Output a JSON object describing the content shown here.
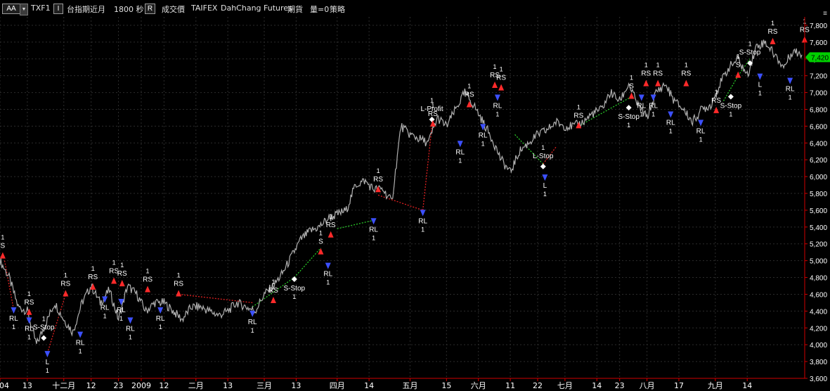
{
  "toolbar": {
    "dropdown_label": "AA",
    "symbol": "TXF1",
    "mode_indicator": "I",
    "name": "台指期近月",
    "interval": "1800 秒",
    "r_indicator": "R",
    "price_type": "成交價",
    "exchange": "TAIFEX",
    "source": "DahChang Futures",
    "market": "期貨",
    "volume": "量=0",
    "strategy": "策略",
    "panel_icon": "≡"
  },
  "colors": {
    "background": "#000000",
    "price_line": "#b0b0b0",
    "grid": "#2c2c2c",
    "axis": "#d00000",
    "long_segment": "#28c828",
    "short_segment": "#e02020",
    "buy_marker": "#3c50ff",
    "sell_marker": "#ff2a2a",
    "exit_marker": "#ffffff",
    "last_price_tag": "#00d000"
  },
  "chart_data": {
    "type": "line",
    "y_ticks": [
      3600,
      3800,
      4000,
      4200,
      4400,
      4600,
      4800,
      5000,
      5200,
      5400,
      5600,
      5800,
      6000,
      6200,
      6400,
      6600,
      6800,
      7000,
      7200,
      7400,
      7600,
      7800
    ],
    "y_tick_labels": [
      "3,600",
      "3,800",
      "4,000",
      "4,200",
      "4,400",
      "4,600",
      "4,800",
      "5,000",
      "5,200",
      "5,400",
      "5,600",
      "5,800",
      "6,000",
      "6,200",
      "6,400",
      "6,600",
      "6,800",
      "7,000",
      "7,200",
      "7,400",
      "7,600",
      "7,800"
    ],
    "ylim": [
      3600,
      7900
    ],
    "x_ticks": [
      "04",
      "13",
      "十二月",
      "12",
      "23",
      "2009",
      "12",
      "二月",
      "13",
      "三月",
      "13",
      "四月",
      "14",
      "五月",
      "15",
      "六月",
      "11",
      "22",
      "七月",
      "14",
      "23",
      "八月",
      "17",
      "九月",
      "14"
    ],
    "x_tick_pos": [
      0,
      3,
      7,
      10,
      13,
      15.5,
      18,
      21.5,
      25,
      29,
      32.5,
      37,
      40.5,
      45,
      49,
      52.5,
      56,
      59,
      62,
      65.5,
      68,
      71,
      74.5,
      78.5,
      82
    ],
    "xlim": [
      0,
      88
    ],
    "last_price": 7420,
    "last_price_label": "7,420",
    "series": [
      {
        "x": [
          0,
          1,
          2,
          3,
          4,
          5,
          6,
          7,
          8,
          9,
          10,
          11,
          12,
          13,
          14,
          15,
          16,
          17,
          18,
          19,
          20,
          21,
          22,
          23,
          24,
          25,
          26,
          27,
          28,
          29,
          30,
          31,
          32,
          33,
          34,
          35,
          36,
          37,
          38,
          39,
          40,
          41,
          42,
          43,
          44,
          45,
          46,
          47,
          48,
          49,
          50,
          51,
          52,
          53,
          54,
          55,
          56,
          57,
          58,
          59,
          60,
          61,
          62,
          63,
          64,
          65,
          66,
          67,
          68,
          69,
          70,
          71,
          72,
          73,
          74,
          75,
          76,
          77,
          78,
          79,
          80,
          81,
          82,
          83,
          84,
          85,
          86,
          87,
          88
        ],
        "values": [
          5000,
          4800,
          4450,
          4400,
          4000,
          4250,
          4500,
          4300,
          4150,
          4500,
          4700,
          4500,
          4650,
          4300,
          4700,
          4600,
          4400,
          4500,
          4500,
          4400,
          4300,
          4450,
          4450,
          4400,
          4350,
          4400,
          4500,
          4450,
          4400,
          4600,
          4700,
          4850,
          5050,
          5250,
          5350,
          5400,
          5500,
          5550,
          5600,
          5900,
          5950,
          5850,
          5850,
          5700,
          6600,
          6500,
          6450,
          6400,
          6700,
          6600,
          6800,
          7000,
          6850,
          6650,
          6450,
          6200,
          6050,
          6300,
          6400,
          6500,
          6550,
          6650,
          6600,
          6600,
          6650,
          6750,
          6800,
          7000,
          6900,
          7100,
          6850,
          6700,
          7000,
          7100,
          6900,
          6800,
          6650,
          6800,
          6850,
          7100,
          7300,
          7400,
          7200,
          7550,
          7600,
          7450,
          7300,
          7500,
          7450
        ]
      }
    ],
    "signals": [
      {
        "x": 0.3,
        "y": 5050,
        "type": "sell",
        "label": "S",
        "qty": "1",
        "pos": "above"
      },
      {
        "x": 1.5,
        "y": 4420,
        "type": "buy",
        "label": "RL",
        "qty": "1",
        "pos": "below"
      },
      {
        "x": 3.2,
        "y": 4380,
        "type": "sell",
        "label": "RS",
        "qty": "1",
        "pos": "above"
      },
      {
        "x": 3.2,
        "y": 4300,
        "type": "buy",
        "label": "RL",
        "qty": "1",
        "pos": "below"
      },
      {
        "x": 4.8,
        "y": 4080,
        "type": "exit",
        "label": "S-Stop",
        "qty": "1",
        "pos": "above"
      },
      {
        "x": 5.2,
        "y": 3900,
        "type": "buy",
        "label": "L",
        "qty": "1",
        "pos": "below"
      },
      {
        "x": 7.2,
        "y": 4600,
        "type": "sell",
        "label": "RS",
        "qty": "1",
        "pos": "above"
      },
      {
        "x": 8.8,
        "y": 4130,
        "type": "buy",
        "label": "RL",
        "qty": "1",
        "pos": "below"
      },
      {
        "x": 10.2,
        "y": 4680,
        "type": "sell",
        "label": "RS",
        "qty": "1",
        "pos": "above"
      },
      {
        "x": 11.5,
        "y": 4550,
        "type": "buy",
        "label": "RL",
        "qty": "1",
        "pos": "below"
      },
      {
        "x": 12.5,
        "y": 4750,
        "type": "sell",
        "label": "RS",
        "qty": "1",
        "pos": "above"
      },
      {
        "x": 13.4,
        "y": 4720,
        "type": "sell",
        "label": "RS",
        "qty": "1",
        "pos": "above"
      },
      {
        "x": 13.3,
        "y": 4520,
        "type": "buy",
        "label": "RL",
        "qty": "1",
        "pos": "below"
      },
      {
        "x": 14.3,
        "y": 4300,
        "type": "buy",
        "label": "RL",
        "qty": "1",
        "pos": "below"
      },
      {
        "x": 16.2,
        "y": 4650,
        "type": "sell",
        "label": "RS",
        "qty": "1",
        "pos": "above"
      },
      {
        "x": 17.6,
        "y": 4420,
        "type": "buy",
        "label": "RL",
        "qty": "1",
        "pos": "below"
      },
      {
        "x": 19.6,
        "y": 4600,
        "type": "sell",
        "label": "RS",
        "qty": "1",
        "pos": "above"
      },
      {
        "x": 27.7,
        "y": 4380,
        "type": "buy",
        "label": "RL",
        "qty": "1",
        "pos": "below"
      },
      {
        "x": 30.0,
        "y": 4520,
        "type": "sell",
        "label": "RS",
        "qty": "1",
        "pos": "above"
      },
      {
        "x": 32.3,
        "y": 4780,
        "type": "exit",
        "label": "S-Stop",
        "qty": "1",
        "pos": "below"
      },
      {
        "x": 35.2,
        "y": 5100,
        "type": "sell",
        "label": "S",
        "qty": "1",
        "pos": "above"
      },
      {
        "x": 36.3,
        "y": 5300,
        "type": "sell",
        "label": "RS",
        "qty": "1",
        "pos": "above"
      },
      {
        "x": 36.0,
        "y": 4950,
        "type": "buy",
        "label": "RL",
        "qty": "1",
        "pos": "below"
      },
      {
        "x": 41.0,
        "y": 5480,
        "type": "buy",
        "label": "RL",
        "qty": "1",
        "pos": "below"
      },
      {
        "x": 41.5,
        "y": 5840,
        "type": "sell",
        "label": "RS",
        "qty": "1",
        "pos": "above"
      },
      {
        "x": 46.4,
        "y": 5580,
        "type": "buy",
        "label": "RL",
        "qty": "1",
        "pos": "below"
      },
      {
        "x": 47.4,
        "y": 6680,
        "type": "exit",
        "label": "L-Profit",
        "qty": "1",
        "pos": "above"
      },
      {
        "x": 47.5,
        "y": 6620,
        "type": "sell",
        "label": "RS",
        "qty": "1",
        "pos": "above"
      },
      {
        "x": 50.5,
        "y": 6400,
        "type": "buy",
        "label": "RL",
        "qty": "1",
        "pos": "below"
      },
      {
        "x": 51.5,
        "y": 6850,
        "type": "sell",
        "label": "RS",
        "qty": "1",
        "pos": "above"
      },
      {
        "x": 53.0,
        "y": 6600,
        "type": "buy",
        "label": "RL",
        "qty": "1",
        "pos": "below"
      },
      {
        "x": 54.3,
        "y": 7080,
        "type": "sell",
        "label": "RS",
        "qty": "1",
        "pos": "above"
      },
      {
        "x": 54.6,
        "y": 6950,
        "type": "buy",
        "label": "RL",
        "qty": "1",
        "pos": "below"
      },
      {
        "x": 55.0,
        "y": 7050,
        "type": "sell",
        "label": "RS",
        "qty": "1",
        "pos": "above"
      },
      {
        "x": 59.6,
        "y": 6120,
        "type": "exit",
        "label": "L-Stop",
        "qty": "1",
        "pos": "above"
      },
      {
        "x": 59.8,
        "y": 6000,
        "type": "buy",
        "label": "L",
        "qty": "1",
        "pos": "below"
      },
      {
        "x": 63.5,
        "y": 6600,
        "type": "sell",
        "label": "RS",
        "qty": "1",
        "pos": "above"
      },
      {
        "x": 69.0,
        "y": 6820,
        "type": "exit",
        "label": "S-Stop",
        "qty": "1",
        "pos": "below"
      },
      {
        "x": 69.3,
        "y": 6950,
        "type": "sell",
        "label": "S",
        "qty": "1",
        "pos": "above"
      },
      {
        "x": 70.4,
        "y": 6950,
        "type": "buy",
        "label": "RL",
        "qty": "1",
        "pos": "below"
      },
      {
        "x": 70.9,
        "y": 7100,
        "type": "sell",
        "label": "RS",
        "qty": "1",
        "pos": "above"
      },
      {
        "x": 71.7,
        "y": 6950,
        "type": "buy",
        "label": "RL",
        "qty": "1",
        "pos": "below"
      },
      {
        "x": 72.2,
        "y": 7100,
        "type": "sell",
        "label": "RS",
        "qty": "1",
        "pos": "above"
      },
      {
        "x": 73.6,
        "y": 6750,
        "type": "buy",
        "label": "RL",
        "qty": "1",
        "pos": "below"
      },
      {
        "x": 75.3,
        "y": 7100,
        "type": "sell",
        "label": "RS",
        "qty": "1",
        "pos": "above"
      },
      {
        "x": 76.9,
        "y": 6650,
        "type": "buy",
        "label": "RL",
        "qty": "1",
        "pos": "below"
      },
      {
        "x": 78.6,
        "y": 6780,
        "type": "sell",
        "label": "RS",
        "qty": "1",
        "pos": "above"
      },
      {
        "x": 80.2,
        "y": 6950,
        "type": "exit",
        "label": "S-Stop",
        "qty": "1",
        "pos": "below"
      },
      {
        "x": 81.0,
        "y": 7200,
        "type": "sell",
        "label": "S",
        "qty": "1",
        "pos": "above"
      },
      {
        "x": 82.3,
        "y": 7350,
        "type": "exit",
        "label": "S-Stop",
        "qty": "1",
        "pos": "above"
      },
      {
        "x": 83.4,
        "y": 7200,
        "type": "buy",
        "label": "L",
        "qty": "1",
        "pos": "below"
      },
      {
        "x": 84.8,
        "y": 7600,
        "type": "sell",
        "label": "RS",
        "qty": "1",
        "pos": "above"
      },
      {
        "x": 86.7,
        "y": 7150,
        "type": "buy",
        "label": "RL",
        "qty": "1",
        "pos": "below"
      },
      {
        "x": 88.3,
        "y": 7620,
        "type": "sell",
        "label": "RS",
        "qty": "1",
        "pos": "above"
      }
    ],
    "segments": [
      {
        "x1": 0.5,
        "y1": 5000,
        "x2": 1.5,
        "y2": 4420,
        "kind": "short"
      },
      {
        "x1": 5.2,
        "y1": 3900,
        "x2": 7.2,
        "y2": 4600,
        "kind": "short"
      },
      {
        "x1": 19.6,
        "y1": 4600,
        "x2": 27.7,
        "y2": 4500,
        "kind": "short"
      },
      {
        "x1": 27.7,
        "y1": 4450,
        "x2": 32.3,
        "y2": 4800,
        "kind": "long"
      },
      {
        "x1": 32.3,
        "y1": 4800,
        "x2": 35.2,
        "y2": 5150,
        "kind": "long"
      },
      {
        "x1": 37.0,
        "y1": 5380,
        "x2": 41.0,
        "y2": 5480,
        "kind": "long"
      },
      {
        "x1": 41.5,
        "y1": 5780,
        "x2": 46.4,
        "y2": 5600,
        "kind": "short"
      },
      {
        "x1": 46.4,
        "y1": 5600,
        "x2": 47.4,
        "y2": 6600,
        "kind": "short"
      },
      {
        "x1": 56.5,
        "y1": 6500,
        "x2": 59.6,
        "y2": 6150,
        "kind": "long"
      },
      {
        "x1": 59.6,
        "y1": 6150,
        "x2": 61.0,
        "y2": 6350,
        "kind": "short"
      },
      {
        "x1": 63.5,
        "y1": 6600,
        "x2": 69.3,
        "y2": 6950,
        "kind": "long"
      },
      {
        "x1": 79.4,
        "y1": 6900,
        "x2": 81.0,
        "y2": 7200,
        "kind": "long"
      },
      {
        "x1": 81.0,
        "y1": 7200,
        "x2": 82.3,
        "y2": 7400,
        "kind": "long"
      }
    ]
  }
}
